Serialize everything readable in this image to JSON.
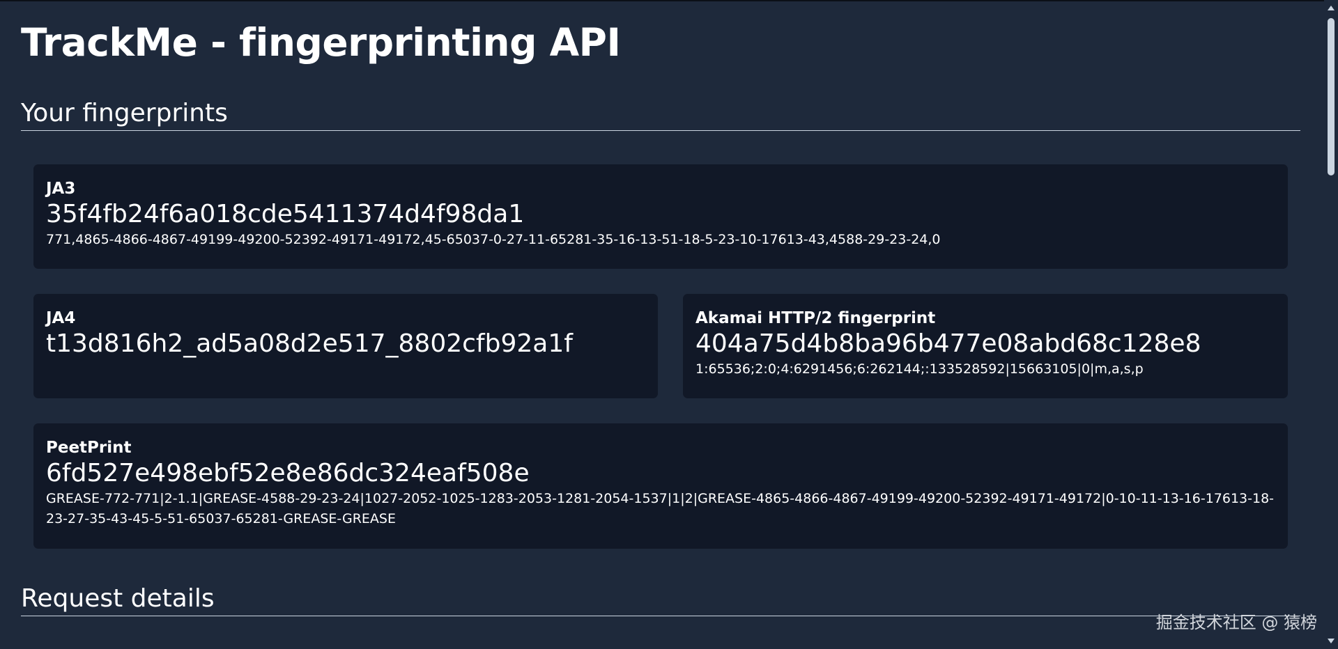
{
  "page_title": "TrackMe - fingerprinting API",
  "sections": {
    "fingerprints_heading": "Your fingerprints",
    "request_heading": "Request details"
  },
  "cards": {
    "ja3": {
      "label": "JA3",
      "hash": "35f4fb24f6a018cde5411374d4f98da1",
      "raw": "771,4865-4866-4867-49199-49200-52392-49171-49172,45-65037-0-27-11-65281-35-16-13-51-18-5-23-10-17613-43,4588-29-23-24,0"
    },
    "ja4": {
      "label": "JA4",
      "hash": "t13d816h2_ad5a08d2e517_8802cfb92a1f"
    },
    "akamai": {
      "label": "Akamai HTTP/2 fingerprint",
      "hash": "404a75d4b8ba96b477e08abd68c128e8",
      "raw": "1:65536;2:0;4:6291456;6:262144;:133528592|15663105|0|m,a,s,p"
    },
    "peetprint": {
      "label": "PeetPrint",
      "hash": "6fd527e498ebf52e8e86dc324eaf508e",
      "raw": "GREASE-772-771|2-1.1|GREASE-4588-29-23-24|1027-2052-1025-1283-2053-1281-2054-1537|1|2|GREASE-4865-4866-4867-49199-49200-52392-49171-49172|0-10-11-13-16-17613-18-23-27-35-43-45-5-51-65037-65281-GREASE-GREASE"
    }
  },
  "watermark": "掘金技术社区 @ 猿榜",
  "colors": {
    "background": "#1e293b",
    "card_background": "#111827",
    "text": "#ffffff",
    "divider": "#cbd5e1"
  }
}
